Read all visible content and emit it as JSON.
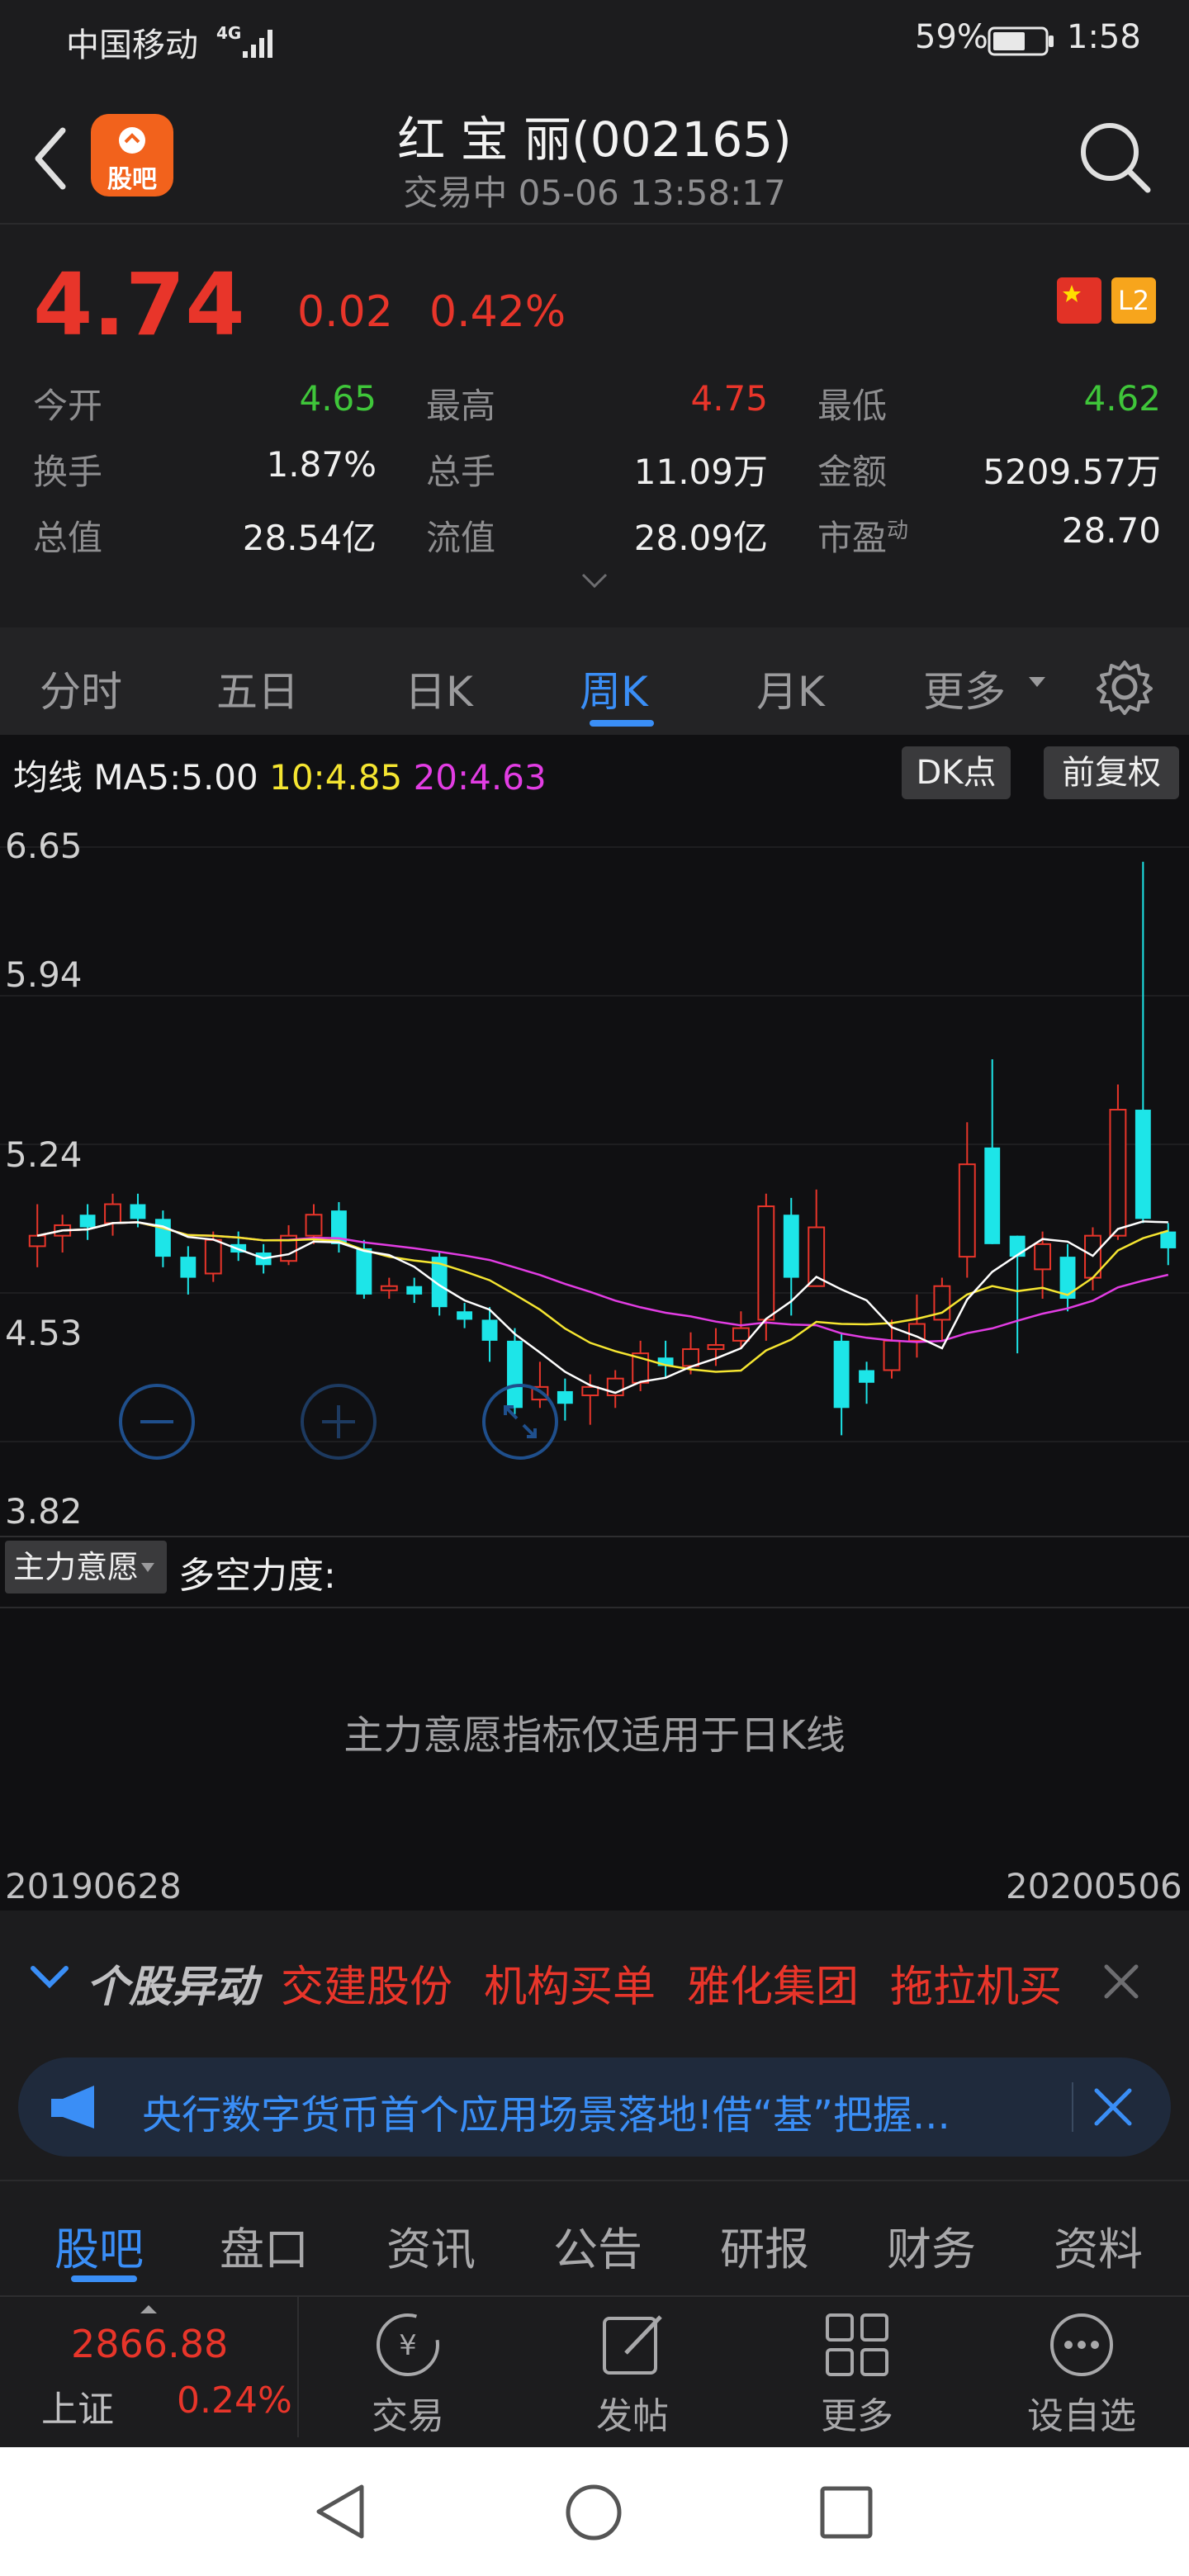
{
  "status_bar": {
    "carrier": "中国移动",
    "network": "4G",
    "battery": "59%",
    "time": "1:58"
  },
  "header": {
    "stock_title": "红 宝 丽(002165)",
    "trade_status": "交易中  05-06 13:58:17",
    "logo_text": "股吧"
  },
  "quote": {
    "price": "4.74",
    "change": "0.02",
    "change_pct": "0.42%",
    "badge_l2": "L2",
    "rows": [
      [
        {
          "label": "今开",
          "value": "4.65",
          "color": "green"
        },
        {
          "label": "最高",
          "value": "4.75",
          "color": "red"
        },
        {
          "label": "最低",
          "value": "4.62",
          "color": "green"
        }
      ],
      [
        {
          "label": "换手",
          "value": "1.87%",
          "color": "white"
        },
        {
          "label": "总手",
          "value": "11.09万",
          "color": "white"
        },
        {
          "label": "金额",
          "value": "5209.57万",
          "color": "white"
        }
      ],
      [
        {
          "label": "总值",
          "value": "28.54亿",
          "color": "white"
        },
        {
          "label": "流值",
          "value": "28.09亿",
          "color": "white"
        },
        {
          "label": "市盈",
          "sup": "动",
          "value": "28.70",
          "color": "white"
        }
      ]
    ]
  },
  "tabs": {
    "items": [
      "分时",
      "五日",
      "日K",
      "周K",
      "月K",
      "更多"
    ],
    "active": "周K"
  },
  "ma_bar": {
    "label": "均线",
    "ma5": "MA5:5.00",
    "ma10": "10:4.85",
    "ma20": "20:4.63",
    "dk_button": "DK点",
    "adjust_button": "前复权"
  },
  "chart_data": {
    "type": "candlestick",
    "y_ticks": [
      "6.65",
      "5.94",
      "5.24",
      "4.53",
      "3.82"
    ],
    "ylim": [
      3.82,
      6.65
    ],
    "start_date": "20190628",
    "end_date": "20200506",
    "candles": [
      [
        4.75,
        4.8,
        4.95,
        4.65
      ],
      [
        4.8,
        4.85,
        4.9,
        4.72
      ],
      [
        4.9,
        4.84,
        4.95,
        4.78
      ],
      [
        4.86,
        4.95,
        5.0,
        4.8
      ],
      [
        4.95,
        4.88,
        5.0,
        4.84
      ],
      [
        4.88,
        4.7,
        4.92,
        4.65
      ],
      [
        4.7,
        4.6,
        4.75,
        4.52
      ],
      [
        4.62,
        4.78,
        4.82,
        4.58
      ],
      [
        4.76,
        4.72,
        4.82,
        4.68
      ],
      [
        4.72,
        4.66,
        4.76,
        4.62
      ],
      [
        4.68,
        4.8,
        4.85,
        4.66
      ],
      [
        4.8,
        4.9,
        4.95,
        4.76
      ],
      [
        4.92,
        4.76,
        4.96,
        4.72
      ],
      [
        4.74,
        4.52,
        4.78,
        4.5
      ],
      [
        4.54,
        4.56,
        4.6,
        4.5
      ],
      [
        4.56,
        4.52,
        4.6,
        4.48
      ],
      [
        4.7,
        4.46,
        4.72,
        4.42
      ],
      [
        4.44,
        4.4,
        4.48,
        4.36
      ],
      [
        4.4,
        4.3,
        4.46,
        4.2
      ],
      [
        4.3,
        3.98,
        4.36,
        3.95
      ],
      [
        4.02,
        4.08,
        4.2,
        3.98
      ],
      [
        4.06,
        4.0,
        4.12,
        3.92
      ],
      [
        4.04,
        4.08,
        4.14,
        3.9
      ],
      [
        4.04,
        4.12,
        4.16,
        3.98
      ],
      [
        4.1,
        4.24,
        4.3,
        4.06
      ],
      [
        4.22,
        4.18,
        4.3,
        4.12
      ],
      [
        4.18,
        4.26,
        4.34,
        4.14
      ],
      [
        4.26,
        4.28,
        4.36,
        4.18
      ],
      [
        4.3,
        4.36,
        4.44,
        4.26
      ],
      [
        4.4,
        4.94,
        5.0,
        4.3
      ],
      [
        4.9,
        4.6,
        4.98,
        4.42
      ],
      [
        4.56,
        4.84,
        5.02,
        4.56
      ],
      [
        4.3,
        3.98,
        4.34,
        3.85
      ],
      [
        4.16,
        4.1,
        4.2,
        4.0
      ],
      [
        4.16,
        4.3,
        4.4,
        4.12
      ],
      [
        4.3,
        4.38,
        4.52,
        4.22
      ],
      [
        4.4,
        4.56,
        4.6,
        4.3
      ],
      [
        4.7,
        5.14,
        5.34,
        4.6
      ],
      [
        5.22,
        4.76,
        5.64,
        4.76
      ],
      [
        4.8,
        4.7,
        4.8,
        4.24
      ],
      [
        4.64,
        4.76,
        4.82,
        4.5
      ],
      [
        4.7,
        4.5,
        4.76,
        4.44
      ],
      [
        4.6,
        4.8,
        4.84,
        4.54
      ],
      [
        4.8,
        5.4,
        5.52,
        4.78
      ],
      [
        5.4,
        4.88,
        6.58,
        4.86
      ],
      [
        4.82,
        4.74,
        4.86,
        4.66
      ]
    ]
  },
  "indicator": {
    "label": "主力意愿",
    "title": "多空力度:",
    "message": "主力意愿指标仅适用于日K线"
  },
  "news_ticker": {
    "title": "个股异动",
    "items": [
      "交建股份",
      "机构买单",
      "雅化集团",
      "拖拉机买"
    ]
  },
  "banner": {
    "text": "央行数字货币首个应用场景落地!借“基”把握..."
  },
  "bottom_tabs": {
    "items": [
      "股吧",
      "盘口",
      "资讯",
      "公告",
      "研报",
      "财务",
      "资料"
    ],
    "active": "股吧"
  },
  "footer": {
    "index_value": "2866.88",
    "index_name": "上证",
    "index_change": "0.24%",
    "buttons": [
      {
        "label": "交易",
        "icon": "trade-icon"
      },
      {
        "label": "发帖",
        "icon": "post-icon"
      },
      {
        "label": "更多",
        "icon": "grid-icon"
      },
      {
        "label": "设自选",
        "icon": "watchlist-icon"
      }
    ]
  },
  "colors": {
    "red": "#e8352a",
    "green": "#3fc63a",
    "cyan": "#1de5e8",
    "accent_blue": "#3a8ef6",
    "ma10": "#f5e531",
    "ma20": "#e23de3"
  }
}
